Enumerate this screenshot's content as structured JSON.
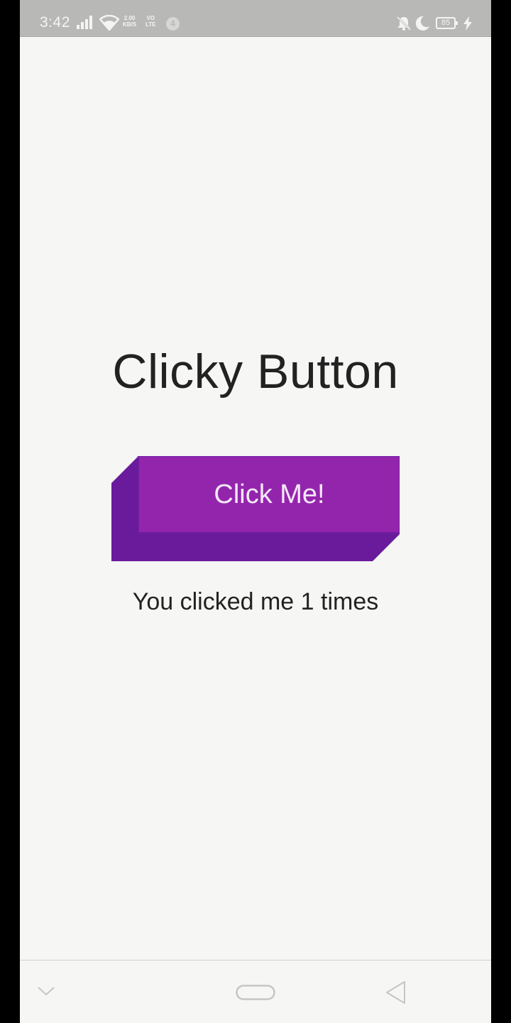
{
  "status_bar": {
    "time": "3:42",
    "speed_value": "2.00",
    "speed_unit": "KB/S",
    "volte_top": "VO",
    "volte_bottom": "LTE",
    "notification_count": "4",
    "battery_level": "85",
    "icons": [
      "signal-icon",
      "wifi-icon",
      "mute-icon",
      "moon-icon",
      "battery-icon",
      "bolt-icon"
    ]
  },
  "main": {
    "title": "Clicky Button",
    "button_label": "Click Me!",
    "click_message": "You clicked me 1 times",
    "colors": {
      "button_face": "#9325ad",
      "button_side": "#691b9c",
      "button_border": "#6f1da0"
    }
  },
  "nav_bar": {
    "icons": [
      "chevron-down-icon",
      "home-pill-icon",
      "back-triangle-icon"
    ]
  }
}
